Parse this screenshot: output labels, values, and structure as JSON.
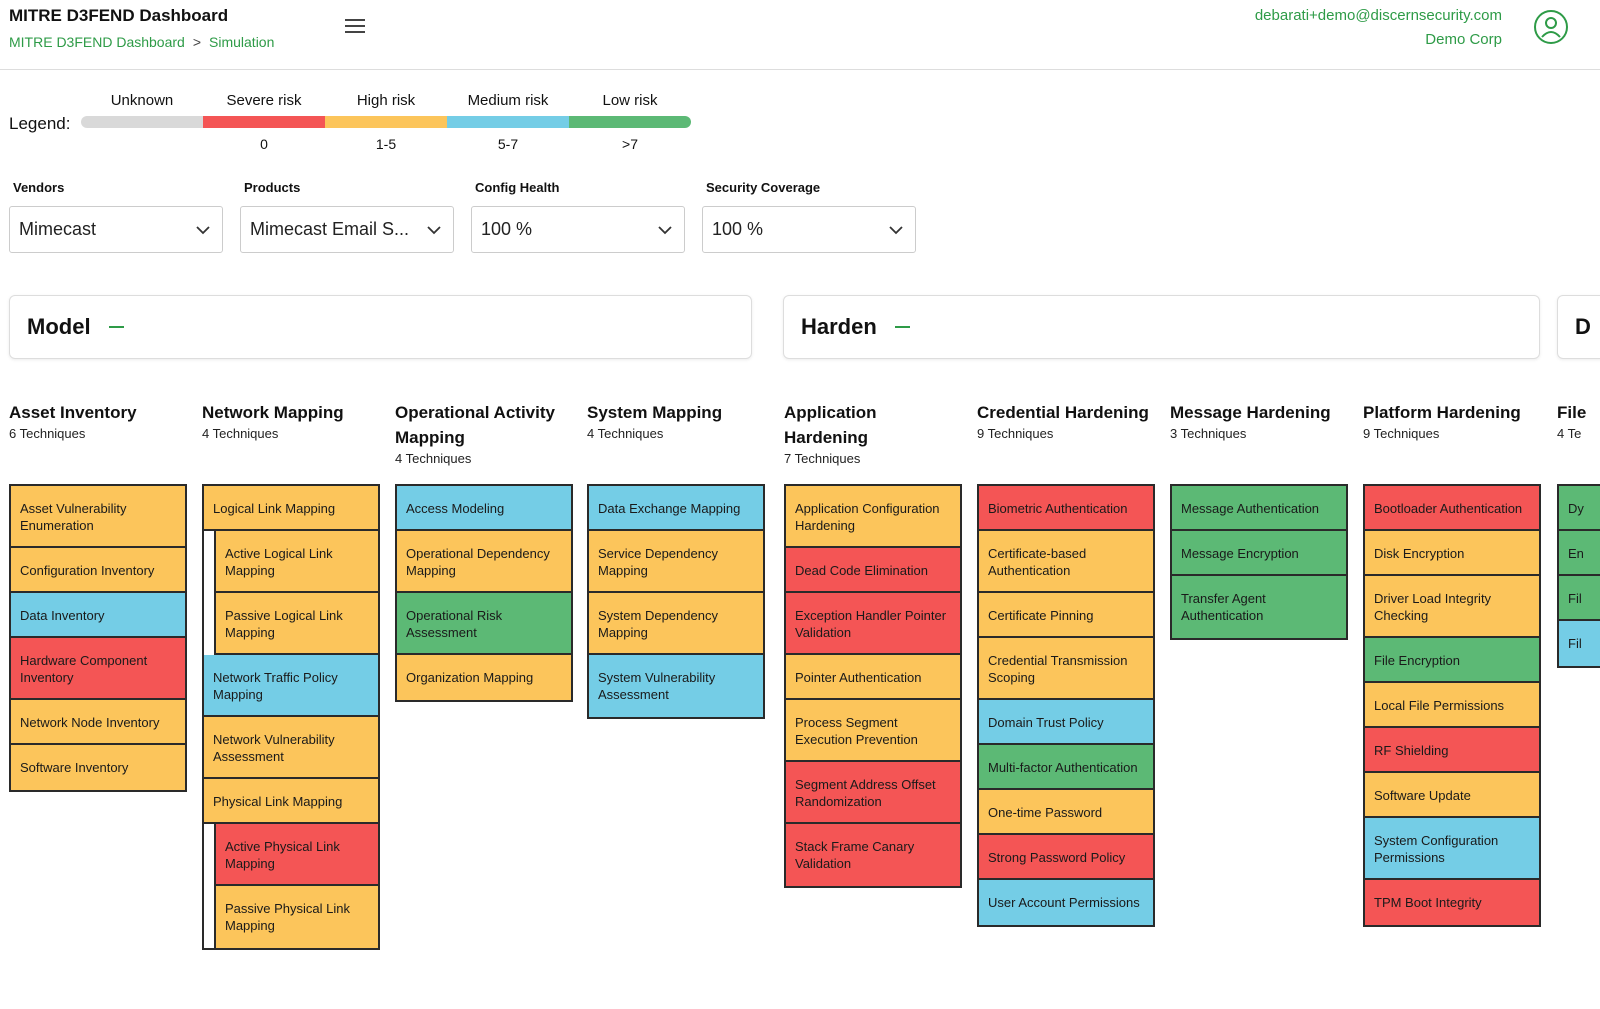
{
  "header": {
    "title": "MITRE D3FEND Dashboard",
    "breadcrumb": [
      "MITRE D3FEND Dashboard",
      "Simulation"
    ],
    "breadcrumb_sep": ">",
    "user_email": "debarati+demo@discernsecurity.com",
    "org": "Demo Corp",
    "accent": "#2e9b47"
  },
  "legend": {
    "label": "Legend:",
    "items": [
      {
        "name": "Unknown",
        "range": "",
        "color": "#d9d9d9"
      },
      {
        "name": "Severe risk",
        "range": "0",
        "color": "#f45555"
      },
      {
        "name": "High risk",
        "range": "1-5",
        "color": "#fcc55b"
      },
      {
        "name": "Medium risk",
        "range": "5-7",
        "color": "#74cde6"
      },
      {
        "name": "Low risk",
        "range": ">7",
        "color": "#5cb975"
      }
    ]
  },
  "filters": [
    {
      "label": "Vendors",
      "value": "Mimecast"
    },
    {
      "label": "Products",
      "value": "Mimecast Email S..."
    },
    {
      "label": "Config Health",
      "value": "100 %"
    },
    {
      "label": "Security Coverage",
      "value": "100 %"
    }
  ],
  "tactics": [
    {
      "title": "Model"
    },
    {
      "title": "Harden"
    },
    {
      "title": "D"
    }
  ],
  "columns": [
    {
      "title": "Asset Inventory",
      "count": "6 Techniques",
      "techniques": [
        {
          "name": "Asset Vulnerability Enumeration",
          "risk": "high",
          "sub": false,
          "rows": 2
        },
        {
          "name": "Configuration Inventory",
          "risk": "high",
          "sub": false,
          "rows": 1
        },
        {
          "name": "Data Inventory",
          "risk": "medium",
          "sub": false,
          "rows": 1
        },
        {
          "name": "Hardware Component Inventory",
          "risk": "severe",
          "sub": false,
          "rows": 2
        },
        {
          "name": "Network Node Inventory",
          "risk": "high",
          "sub": false,
          "rows": 1
        },
        {
          "name": "Software Inventory",
          "risk": "high",
          "sub": false,
          "rows": 1
        }
      ]
    },
    {
      "title": "Network Mapping",
      "count": "4 Techniques",
      "techniques": [
        {
          "name": "Logical Link Mapping",
          "risk": "high",
          "sub": false,
          "rows": 1
        },
        {
          "name": "Active Logical Link Mapping",
          "risk": "high",
          "sub": true,
          "rows": 2
        },
        {
          "name": "Passive Logical Link Mapping",
          "risk": "high",
          "sub": true,
          "rows": 2
        },
        {
          "name": "Network Traffic Policy Mapping",
          "risk": "medium",
          "sub": false,
          "rows": 2
        },
        {
          "name": "Network Vulnerability Assessment",
          "risk": "high",
          "sub": false,
          "rows": 2
        },
        {
          "name": "Physical Link Mapping",
          "risk": "high",
          "sub": false,
          "rows": 1
        },
        {
          "name": "Active Physical Link Mapping",
          "risk": "severe",
          "sub": true,
          "rows": 2
        },
        {
          "name": "Passive Physical Link Mapping",
          "risk": "high",
          "sub": true,
          "rows": 2
        }
      ]
    },
    {
      "title": "Operational Activity Mapping",
      "count": "4 Techniques",
      "techniques": [
        {
          "name": "Access Modeling",
          "risk": "medium",
          "sub": false,
          "rows": 1
        },
        {
          "name": "Operational Dependency Mapping",
          "risk": "high",
          "sub": false,
          "rows": 2
        },
        {
          "name": "Operational Risk Assessment",
          "risk": "low",
          "sub": false,
          "rows": 2
        },
        {
          "name": "Organization Mapping",
          "risk": "high",
          "sub": false,
          "rows": 1
        }
      ]
    },
    {
      "title": "System Mapping",
      "count": "4 Techniques",
      "techniques": [
        {
          "name": "Data Exchange Mapping",
          "risk": "medium",
          "sub": false,
          "rows": 1
        },
        {
          "name": "Service Dependency Mapping",
          "risk": "high",
          "sub": false,
          "rows": 2
        },
        {
          "name": "System Dependency Mapping",
          "risk": "high",
          "sub": false,
          "rows": 2
        },
        {
          "name": "System Vulnerability Assessment",
          "risk": "medium",
          "sub": false,
          "rows": 2
        }
      ]
    },
    {
      "title": "Application Hardening",
      "count": "7 Techniques",
      "techniques": [
        {
          "name": "Application Configuration Hardening",
          "risk": "high",
          "sub": false,
          "rows": 2
        },
        {
          "name": "Dead Code Elimination",
          "risk": "severe",
          "sub": false,
          "rows": 1
        },
        {
          "name": "Exception Handler Pointer Validation",
          "risk": "severe",
          "sub": false,
          "rows": 2
        },
        {
          "name": "Pointer Authentication",
          "risk": "high",
          "sub": false,
          "rows": 1
        },
        {
          "name": "Process Segment Execution Prevention",
          "risk": "high",
          "sub": false,
          "rows": 2
        },
        {
          "name": "Segment Address Offset Randomization",
          "risk": "severe",
          "sub": false,
          "rows": 2
        },
        {
          "name": "Stack Frame Canary Validation",
          "risk": "severe",
          "sub": false,
          "rows": 2
        }
      ]
    },
    {
      "title": "Credential Hardening",
      "count": "9 Techniques",
      "techniques": [
        {
          "name": "Biometric Authentication",
          "risk": "severe",
          "sub": false,
          "rows": 1
        },
        {
          "name": "Certificate-based Authentication",
          "risk": "high",
          "sub": false,
          "rows": 2
        },
        {
          "name": "Certificate Pinning",
          "risk": "high",
          "sub": false,
          "rows": 1
        },
        {
          "name": "Credential Transmission Scoping",
          "risk": "high",
          "sub": false,
          "rows": 2
        },
        {
          "name": "Domain Trust Policy",
          "risk": "medium",
          "sub": false,
          "rows": 1
        },
        {
          "name": "Multi-factor Authentication",
          "risk": "low",
          "sub": false,
          "rows": 1
        },
        {
          "name": "One-time Password",
          "risk": "high",
          "sub": false,
          "rows": 1
        },
        {
          "name": "Strong Password Policy",
          "risk": "severe",
          "sub": false,
          "rows": 1
        },
        {
          "name": "User Account Permissions",
          "risk": "medium",
          "sub": false,
          "rows": 1
        }
      ]
    },
    {
      "title": "Message Hardening",
      "count": "3 Techniques",
      "techniques": [
        {
          "name": "Message Authentication",
          "risk": "low",
          "sub": false,
          "rows": 1
        },
        {
          "name": "Message Encryption",
          "risk": "low",
          "sub": false,
          "rows": 1
        },
        {
          "name": "Transfer Agent Authentication",
          "risk": "low",
          "sub": false,
          "rows": 2
        }
      ]
    },
    {
      "title": "Platform Hardening",
      "count": "9 Techniques",
      "techniques": [
        {
          "name": "Bootloader Authentication",
          "risk": "severe",
          "sub": false,
          "rows": 1
        },
        {
          "name": "Disk Encryption",
          "risk": "high",
          "sub": false,
          "rows": 1
        },
        {
          "name": "Driver Load Integrity Checking",
          "risk": "high",
          "sub": false,
          "rows": 2
        },
        {
          "name": "File Encryption",
          "risk": "low",
          "sub": false,
          "rows": 1
        },
        {
          "name": "Local File Permissions",
          "risk": "high",
          "sub": false,
          "rows": 1
        },
        {
          "name": "RF Shielding",
          "risk": "severe",
          "sub": false,
          "rows": 1
        },
        {
          "name": "Software Update",
          "risk": "high",
          "sub": false,
          "rows": 1
        },
        {
          "name": "System Configuration Permissions",
          "risk": "medium",
          "sub": false,
          "rows": 2
        },
        {
          "name": "TPM Boot Integrity",
          "risk": "severe",
          "sub": false,
          "rows": 1
        }
      ]
    },
    {
      "title": "File",
      "count": "4 Te",
      "techniques": [
        {
          "name": "Dy",
          "risk": "low",
          "sub": false,
          "rows": 1
        },
        {
          "name": "En",
          "risk": "low",
          "sub": false,
          "rows": 1
        },
        {
          "name": "Fil",
          "risk": "low",
          "sub": false,
          "rows": 1
        },
        {
          "name": "Fil",
          "risk": "medium",
          "sub": false,
          "rows": 1
        }
      ]
    }
  ]
}
